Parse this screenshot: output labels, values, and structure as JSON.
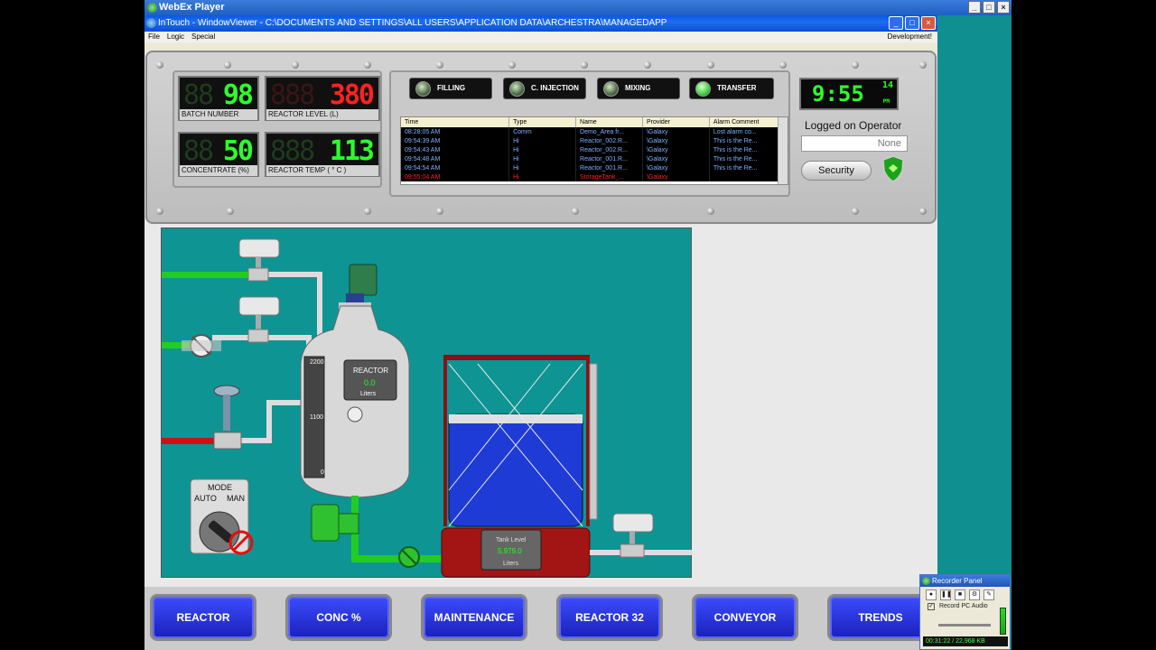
{
  "webex": {
    "title": "WebEx Player",
    "controls": [
      "_",
      "□",
      "×"
    ]
  },
  "window": {
    "title": "InTouch - WindowViewer - C:\\DOCUMENTS AND SETTINGS\\ALL USERS\\APPLICATION DATA\\ARCHESTRA\\MANAGEDAPP",
    "buttons": [
      "_",
      "□",
      "×"
    ]
  },
  "menu": {
    "items": [
      "File",
      "Logic",
      "Special"
    ],
    "right": "Development!"
  },
  "readouts": {
    "batch_number": {
      "value": "98",
      "label": "BATCH NUMBER"
    },
    "reactor_level": {
      "value": "380",
      "label": "REACTOR LEVEL (L)"
    },
    "concentrate": {
      "value": "50",
      "label": "CONCENTRATE (%)"
    },
    "reactor_temp": {
      "value": "113",
      "label": "REACTOR TEMP ( ° C )"
    }
  },
  "modes": [
    {
      "label": "FILLING",
      "on": false
    },
    {
      "label": "C. INJECTION",
      "on": false
    },
    {
      "label": "MIXING",
      "on": false
    },
    {
      "label": "TRANSFER",
      "on": true
    }
  ],
  "alarms": {
    "columns": [
      "Time",
      "Type",
      "Name",
      "Provider",
      "Alarm Comment"
    ],
    "rows": [
      [
        "08:28:05 AM",
        "Comm",
        "Demo_Area fr...",
        "\\Galaxy",
        "Lost alarm co..."
      ],
      [
        "09:54:39 AM",
        "Hi",
        "Reactor_002.R...",
        "\\Galaxy",
        "This is the Re..."
      ],
      [
        "09:54:43 AM",
        "Hi",
        "Reactor_002.R...",
        "\\Galaxy",
        "This is the Re..."
      ],
      [
        "09:54:48 AM",
        "Hi",
        "Reactor_001.R...",
        "\\Galaxy",
        "This is the Re..."
      ],
      [
        "09:54:54 AM",
        "Hi",
        "Reactor_001.R...",
        "\\Galaxy",
        "This is the Re..."
      ],
      [
        "09:55:04 AM",
        "Hi",
        "StorageTank_...",
        "\\Galaxy",
        ""
      ]
    ]
  },
  "clock": {
    "time": "9:55",
    "seconds": "14",
    "ampm": "PM"
  },
  "operator": {
    "heading": "Logged on Operator",
    "value": "None",
    "security_label": "Security"
  },
  "process": {
    "reactor": {
      "title": "REACTOR",
      "value": "0.0",
      "unit": "Liters",
      "scale_top": "2200",
      "scale_mid": "1100",
      "scale_bottom": "0"
    },
    "mode_switch": {
      "title": "MODE",
      "auto": "AUTO",
      "man": "MAN"
    },
    "tank": {
      "title": "Tank Level",
      "value": "5,979.0",
      "unit": "Liters"
    }
  },
  "nav": [
    "REACTOR",
    "CONC %",
    "MAINTENANCE",
    "REACTOR 32",
    "CONVEYOR",
    "TRENDS"
  ],
  "recorder": {
    "title": "Recorder Panel",
    "audio_label": "Record PC Audio",
    "status": "00:31:22 / 22,968 KB"
  },
  "colors": {
    "digit_green": "#2dff2d",
    "digit_red": "#ff2222",
    "process_bg": "#0f9494",
    "nav_button": "#2a33e0",
    "pipe_green": "#22cc22",
    "pipe_red": "#cc1111",
    "tank_liquid": "#1f3bd6"
  }
}
